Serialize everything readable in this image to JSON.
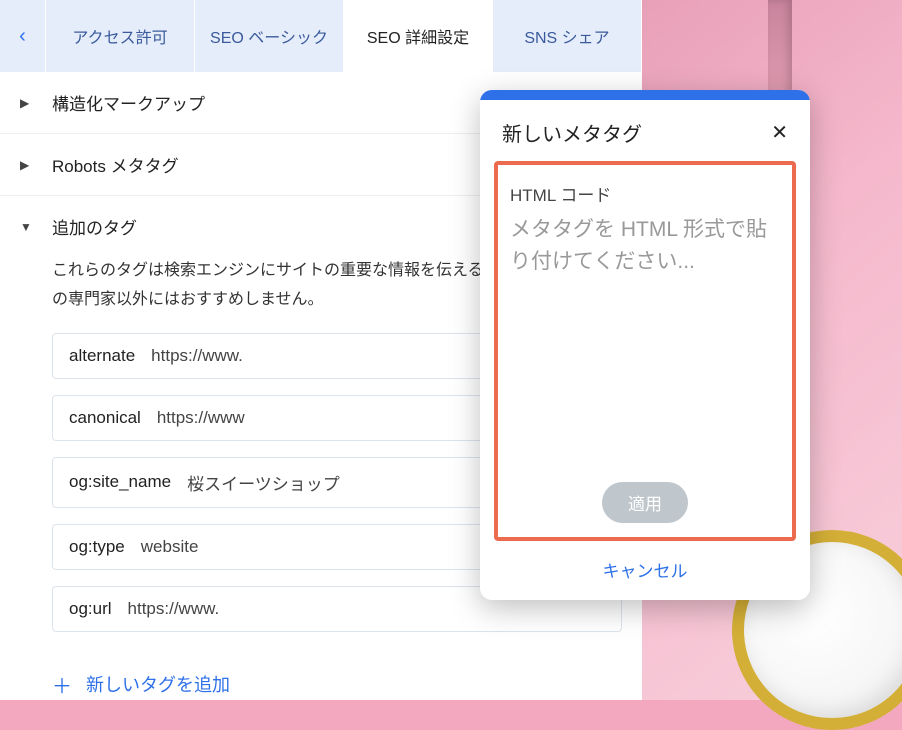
{
  "tabs": {
    "access": "アクセス許可",
    "seo_basic": "SEO ベーシック",
    "seo_adv": "SEO 詳細設定",
    "sns": "SNS シェア"
  },
  "sections": {
    "structured": "構造化マークアップ",
    "robots": "Robots メタタグ",
    "additional": "追加のタグ",
    "additional_desc": "これらのタグは検索エンジンにサイトの重要な情報を伝えるため、変更は SEO の専門家以外にはおすすめしません。"
  },
  "tags": [
    {
      "key": "alternate",
      "value": "https://www."
    },
    {
      "key": "canonical",
      "value": "https://www"
    },
    {
      "key": "og:site_name",
      "value": "桜スイーツショップ"
    },
    {
      "key": "og:type",
      "value": "website"
    },
    {
      "key": "og:url",
      "value": "https://www."
    }
  ],
  "add_tag_label": "新しいタグを追加",
  "dialog": {
    "title": "新しいメタタグ",
    "field_label": "HTML コード",
    "placeholder": "メタタグを HTML 形式で貼り付けてください...",
    "apply": "適用",
    "cancel": "キャンセル"
  }
}
